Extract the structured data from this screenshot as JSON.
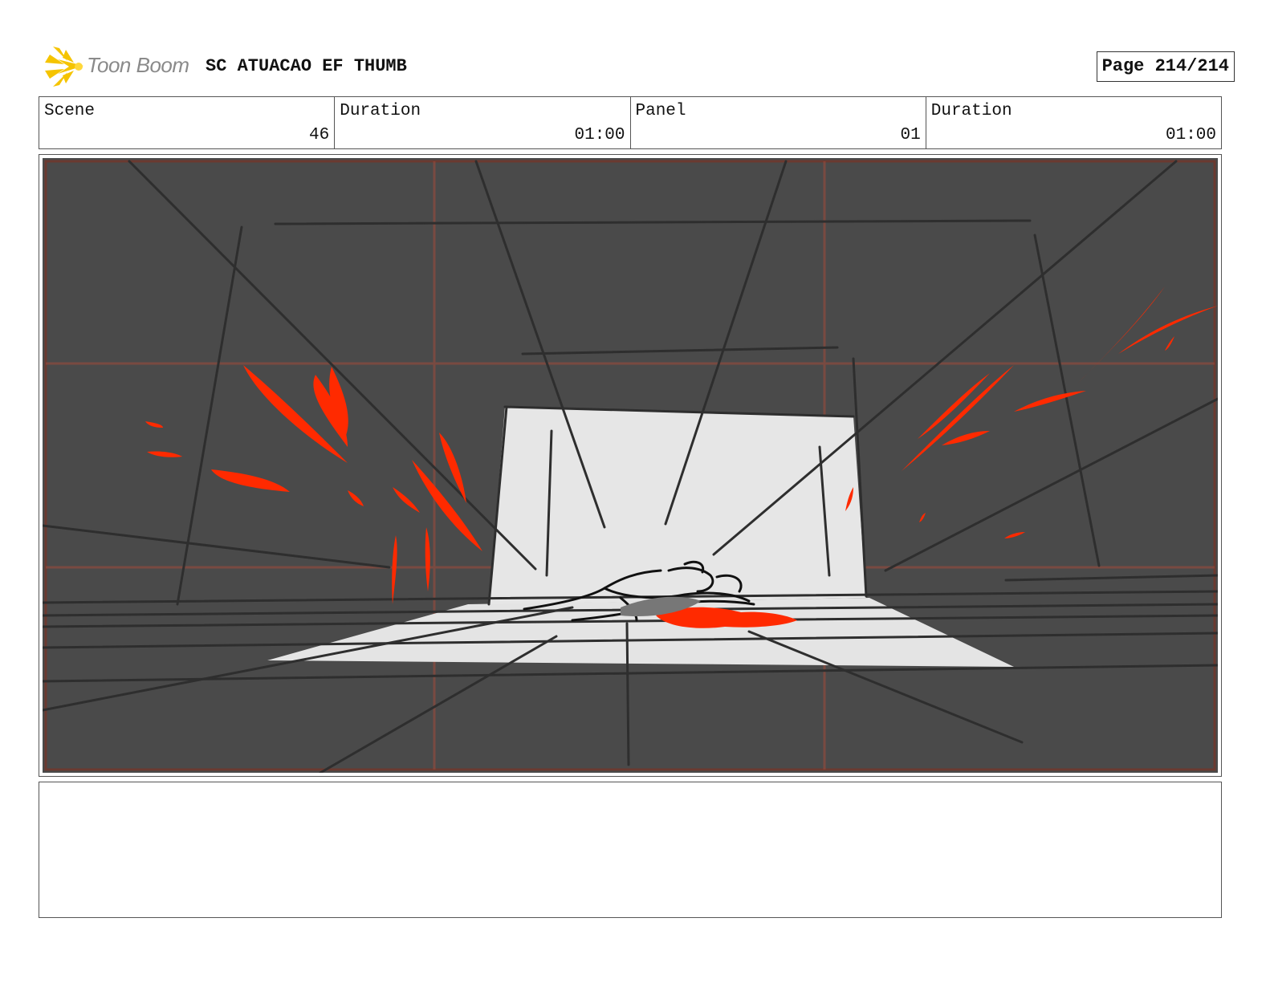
{
  "header": {
    "logo_text": "Toon Boom",
    "title": "SC ATUACAO EF THUMB",
    "page_label": "Page 214/214"
  },
  "info": {
    "scene_label": "Scene",
    "scene_value": "46",
    "scene_duration_label": "Duration",
    "scene_duration_value": "01:00",
    "panel_label": "Panel",
    "panel_value": "01",
    "panel_duration_label": "Duration",
    "panel_duration_value": "01:00"
  },
  "colors": {
    "logo_accent": "#f5c400",
    "sketch_background": "#4a4a4a",
    "blood_red": "#ff2a00",
    "guide_lines": "#a04a3a"
  },
  "notes": ""
}
